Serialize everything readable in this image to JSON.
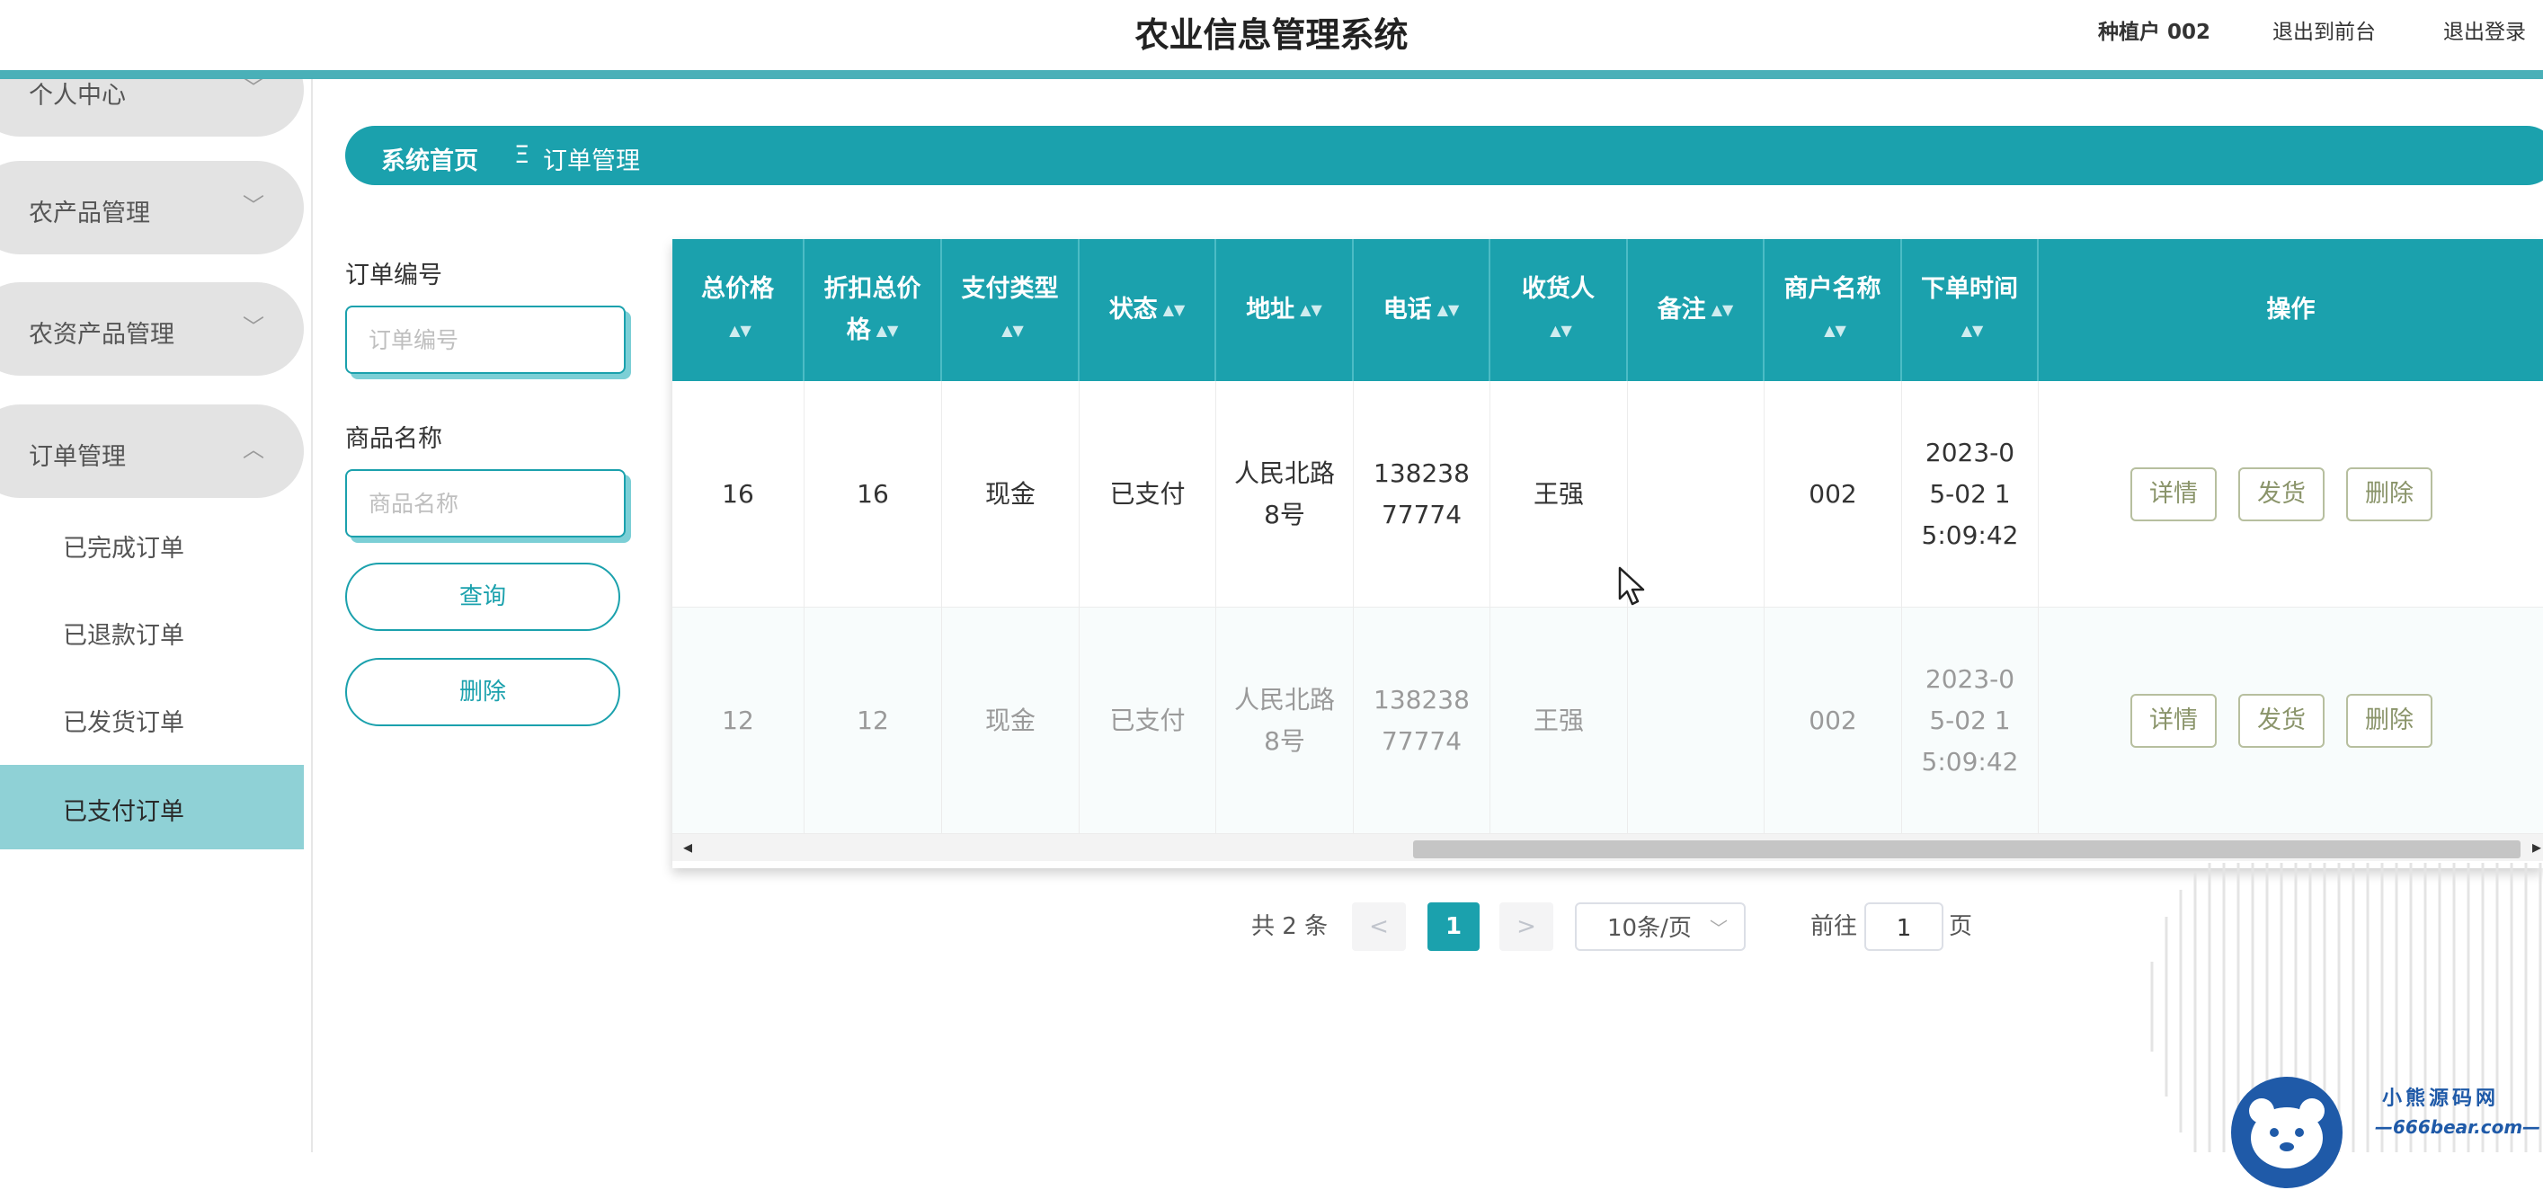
{
  "header": {
    "title": "农业信息管理系统",
    "user": "种植户 002",
    "exit_front": "退出到前台",
    "logout": "退出登录"
  },
  "sidebar": {
    "items": [
      {
        "label": "个人中心",
        "chevron": "chevron-down-icon"
      },
      {
        "label": "农产品管理",
        "chevron": "chevron-down-icon"
      },
      {
        "label": "农资产品管理",
        "chevron": "chevron-down-icon"
      },
      {
        "label": "订单管理",
        "chevron": "chevron-up-icon"
      }
    ],
    "sub_items": [
      {
        "label": "已完成订单",
        "active": false
      },
      {
        "label": "已退款订单",
        "active": false
      },
      {
        "label": "已发货订单",
        "active": false
      },
      {
        "label": "已支付订单",
        "active": true
      }
    ]
  },
  "breadcrumb": {
    "home": "系统首页",
    "separator": "Ξ",
    "current": "订单管理"
  },
  "search": {
    "order_no_label": "订单编号",
    "order_no_placeholder": "订单编号",
    "product_label": "商品名称",
    "product_placeholder": "商品名称",
    "query_button": "查询",
    "delete_button": "删除"
  },
  "table": {
    "columns": [
      {
        "label": "总价格",
        "sortable": true
      },
      {
        "label": "折扣总价格",
        "sortable": true
      },
      {
        "label": "支付类型",
        "sortable": true
      },
      {
        "label": "状态",
        "sortable": true
      },
      {
        "label": "地址",
        "sortable": true
      },
      {
        "label": "电话",
        "sortable": true
      },
      {
        "label": "收货人",
        "sortable": true
      },
      {
        "label": "备注",
        "sortable": true
      },
      {
        "label": "商户名称",
        "sortable": true
      },
      {
        "label": "下单时间",
        "sortable": true
      },
      {
        "label": "操作",
        "sortable": false
      }
    ],
    "rows": [
      {
        "total": "16",
        "discount": "16",
        "pay_type": "现金",
        "status": "已支付",
        "address": "人民北路8号",
        "phone": "13823877774",
        "receiver": "王强",
        "remark": "",
        "merchant": "002",
        "time": "2023-05-02 15:09:42"
      },
      {
        "total": "12",
        "discount": "12",
        "pay_type": "现金",
        "status": "已支付",
        "address": "人民北路8号",
        "phone": "13823877774",
        "receiver": "王强",
        "remark": "",
        "merchant": "002",
        "time": "2023-05-02 15:09:42"
      }
    ],
    "actions": {
      "detail": "详情",
      "ship": "发货",
      "delete": "删除"
    }
  },
  "pagination": {
    "total_text": "共 2 条",
    "prev": "<",
    "current": "1",
    "next": ">",
    "page_size": "10条/页",
    "goto_label": "前往",
    "goto_value": "1",
    "page_suffix": "页"
  },
  "watermark": {
    "name": "小熊源码网",
    "url": "—666bear.com—"
  },
  "colors": {
    "primary": "#1ba1ad",
    "light": "#8fd1d6",
    "header_line": "#4ab0b8"
  }
}
